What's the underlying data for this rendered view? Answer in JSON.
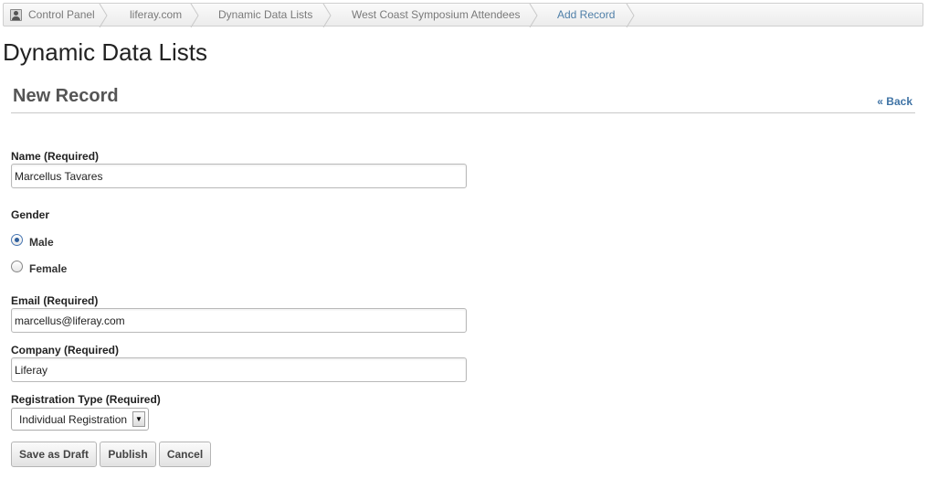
{
  "breadcrumb": [
    {
      "label": "Control Panel"
    },
    {
      "label": "liferay.com"
    },
    {
      "label": "Dynamic Data Lists"
    },
    {
      "label": "West Coast Symposium Attendees"
    },
    {
      "label": "Add Record"
    }
  ],
  "page_title": "Dynamic Data Lists",
  "section": {
    "title": "New Record",
    "back_label": "« Back"
  },
  "form": {
    "name": {
      "label": "Name (Required)",
      "value": "Marcellus Tavares"
    },
    "gender": {
      "label": "Gender",
      "options": [
        {
          "label": "Male",
          "checked": true
        },
        {
          "label": "Female",
          "checked": false
        }
      ]
    },
    "email": {
      "label": "Email (Required)",
      "value": "marcellus@liferay.com"
    },
    "company": {
      "label": "Company (Required)",
      "value": "Liferay"
    },
    "registration_type": {
      "label": "Registration Type (Required)",
      "selected": "Individual Registration"
    }
  },
  "buttons": {
    "save_draft": "Save as Draft",
    "publish": "Publish",
    "cancel": "Cancel"
  }
}
